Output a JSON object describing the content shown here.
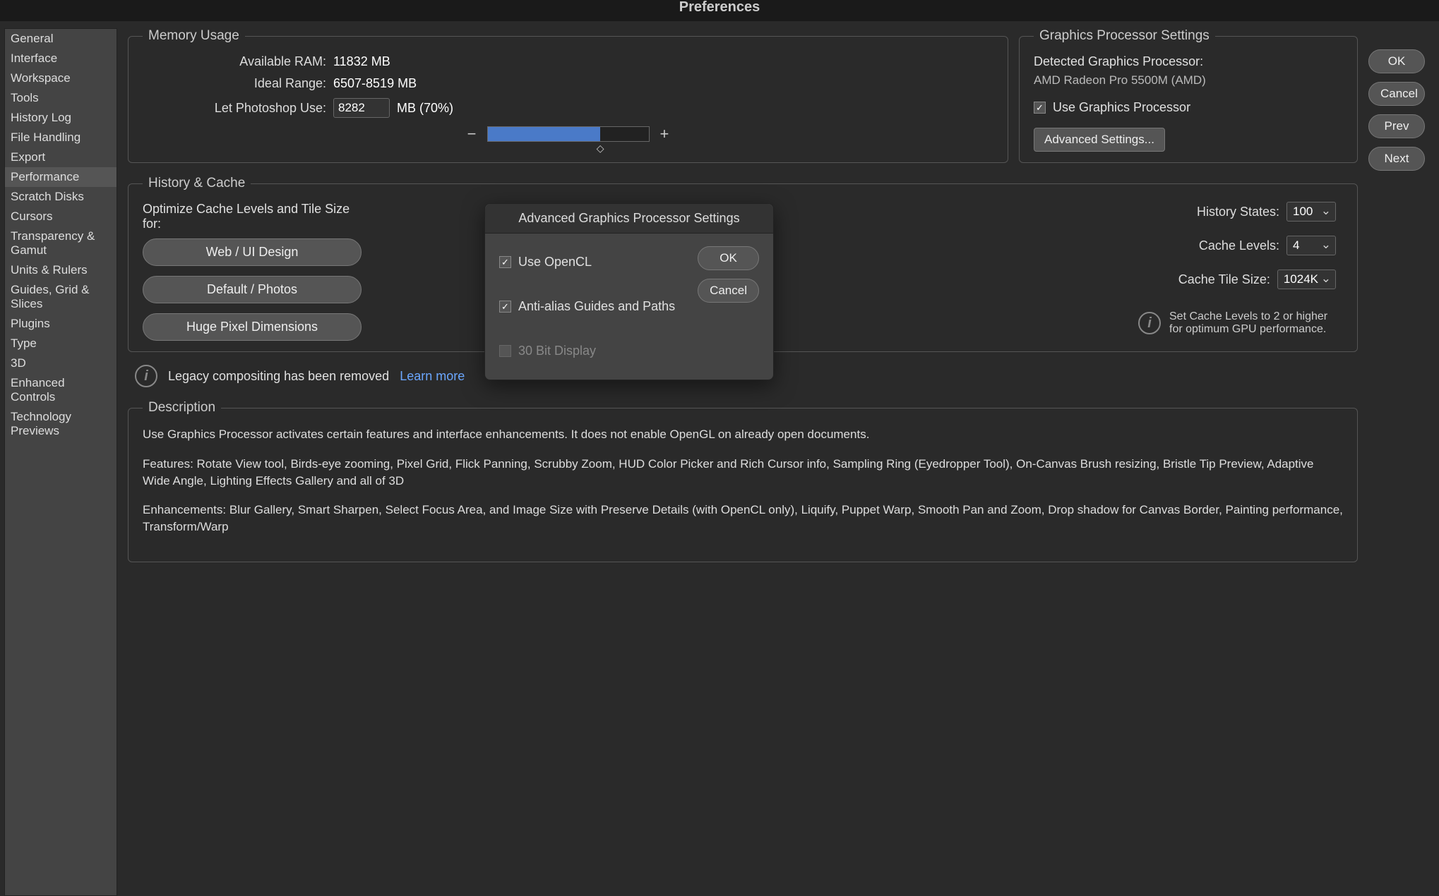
{
  "window_title": "Preferences",
  "sidebar": {
    "items": [
      {
        "label": "General"
      },
      {
        "label": "Interface"
      },
      {
        "label": "Workspace"
      },
      {
        "label": "Tools"
      },
      {
        "label": "History Log"
      },
      {
        "label": "File Handling"
      },
      {
        "label": "Export"
      },
      {
        "label": "Performance"
      },
      {
        "label": "Scratch Disks"
      },
      {
        "label": "Cursors"
      },
      {
        "label": "Transparency & Gamut"
      },
      {
        "label": "Units & Rulers"
      },
      {
        "label": "Guides, Grid & Slices"
      },
      {
        "label": "Plugins"
      },
      {
        "label": "Type"
      },
      {
        "label": "3D"
      },
      {
        "label": "Enhanced Controls"
      },
      {
        "label": "Technology Previews"
      }
    ],
    "selected_index": 7
  },
  "buttons": {
    "ok": "OK",
    "cancel": "Cancel",
    "prev": "Prev",
    "next": "Next"
  },
  "memory": {
    "legend": "Memory Usage",
    "available_label": "Available RAM:",
    "available_value": "11832 MB",
    "ideal_label": "Ideal Range:",
    "ideal_value": "6507-8519 MB",
    "use_label": "Let Photoshop Use:",
    "use_value": "8282",
    "use_suffix": "MB (70%)"
  },
  "gpu": {
    "legend": "Graphics Processor Settings",
    "detected_label": "Detected Graphics Processor:",
    "detected_value": "AMD Radeon Pro 5500M (AMD)",
    "use_gpu_label": "Use Graphics Processor",
    "advanced_button": "Advanced Settings..."
  },
  "history": {
    "legend": "History & Cache",
    "optimize_label": "Optimize Cache Levels and Tile Size for:",
    "presets": [
      "Web / UI Design",
      "Default / Photos",
      "Huge Pixel Dimensions"
    ],
    "history_states_label": "History States:",
    "history_states_value": "100",
    "cache_levels_label": "Cache Levels:",
    "cache_levels_value": "4",
    "cache_tile_label": "Cache Tile Size:",
    "cache_tile_value": "1024K",
    "hint": "Set Cache Levels to 2 or higher for optimum GPU performance."
  },
  "legacy": {
    "text": "Legacy compositing has been removed",
    "link": "Learn more"
  },
  "description": {
    "legend": "Description",
    "p1": "Use Graphics Processor activates certain features and interface enhancements. It does not enable OpenGL on already open documents.",
    "p2": "Features: Rotate View tool, Birds-eye zooming, Pixel Grid, Flick Panning, Scrubby Zoom, HUD Color Picker and Rich Cursor info, Sampling Ring (Eyedropper Tool), On-Canvas Brush resizing, Bristle Tip Preview, Adaptive Wide Angle, Lighting Effects Gallery and all of 3D",
    "p3": "Enhancements: Blur Gallery, Smart Sharpen, Select Focus Area, and Image Size with Preserve Details (with OpenCL only), Liquify, Puppet Warp, Smooth Pan and Zoom, Drop shadow for Canvas Border, Painting performance, Transform/Warp"
  },
  "dialog": {
    "title": "Advanced Graphics Processor Settings",
    "opt1": "Use OpenCL",
    "opt2": "Anti-alias Guides and Paths",
    "opt3": "30 Bit Display",
    "ok": "OK",
    "cancel": "Cancel"
  }
}
